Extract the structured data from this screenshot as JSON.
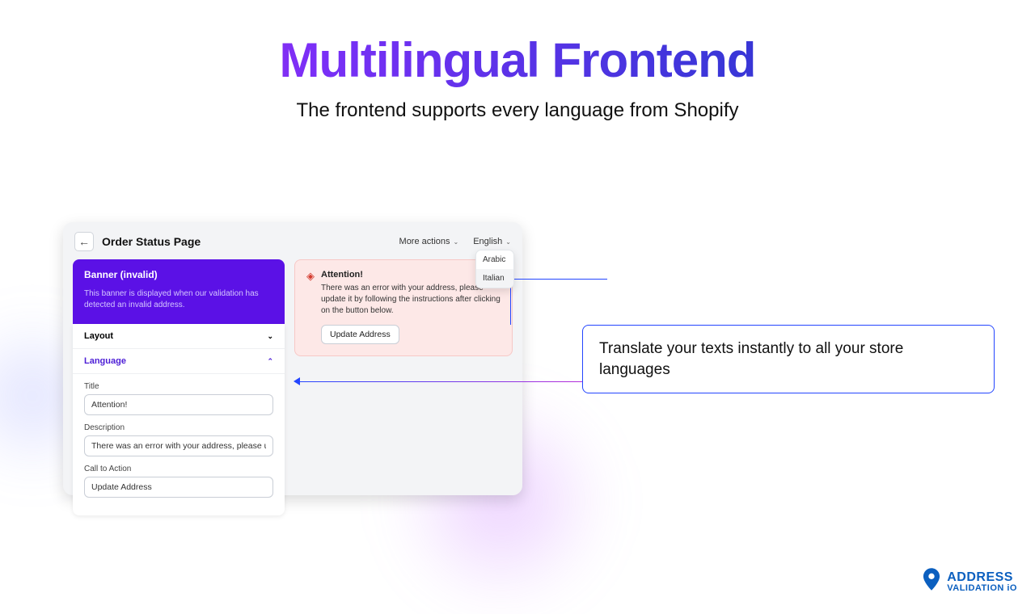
{
  "hero": {
    "title": "Multilingual Frontend",
    "subtitle": "The frontend supports every language from Shopify"
  },
  "panel": {
    "title": "Order Status Page",
    "more_actions": "More actions",
    "language_selector": "English",
    "dropdown": {
      "opt1": "Arabic",
      "opt2": "Italian"
    },
    "purple": {
      "title": "Banner (invalid)",
      "desc": "This banner is displayed when our validation has detected an invalid address."
    },
    "accordion": {
      "layout": "Layout",
      "language": "Language"
    },
    "form": {
      "title_label": "Title",
      "title_value": "Attention!",
      "desc_label": "Description",
      "desc_value": "There was an error with your address, please update it b",
      "cta_label": "Call to Action",
      "cta_value": "Update Address"
    },
    "alert": {
      "title": "Attention!",
      "desc": "There was an error with your address, please update it by following the instructions after clicking on the button below.",
      "cta": "Update Address"
    }
  },
  "callout": {
    "text": "Translate your texts instantly to all your store languages"
  },
  "brand": {
    "line1": "ADDRESS",
    "line2": "VALIDATION iO"
  }
}
